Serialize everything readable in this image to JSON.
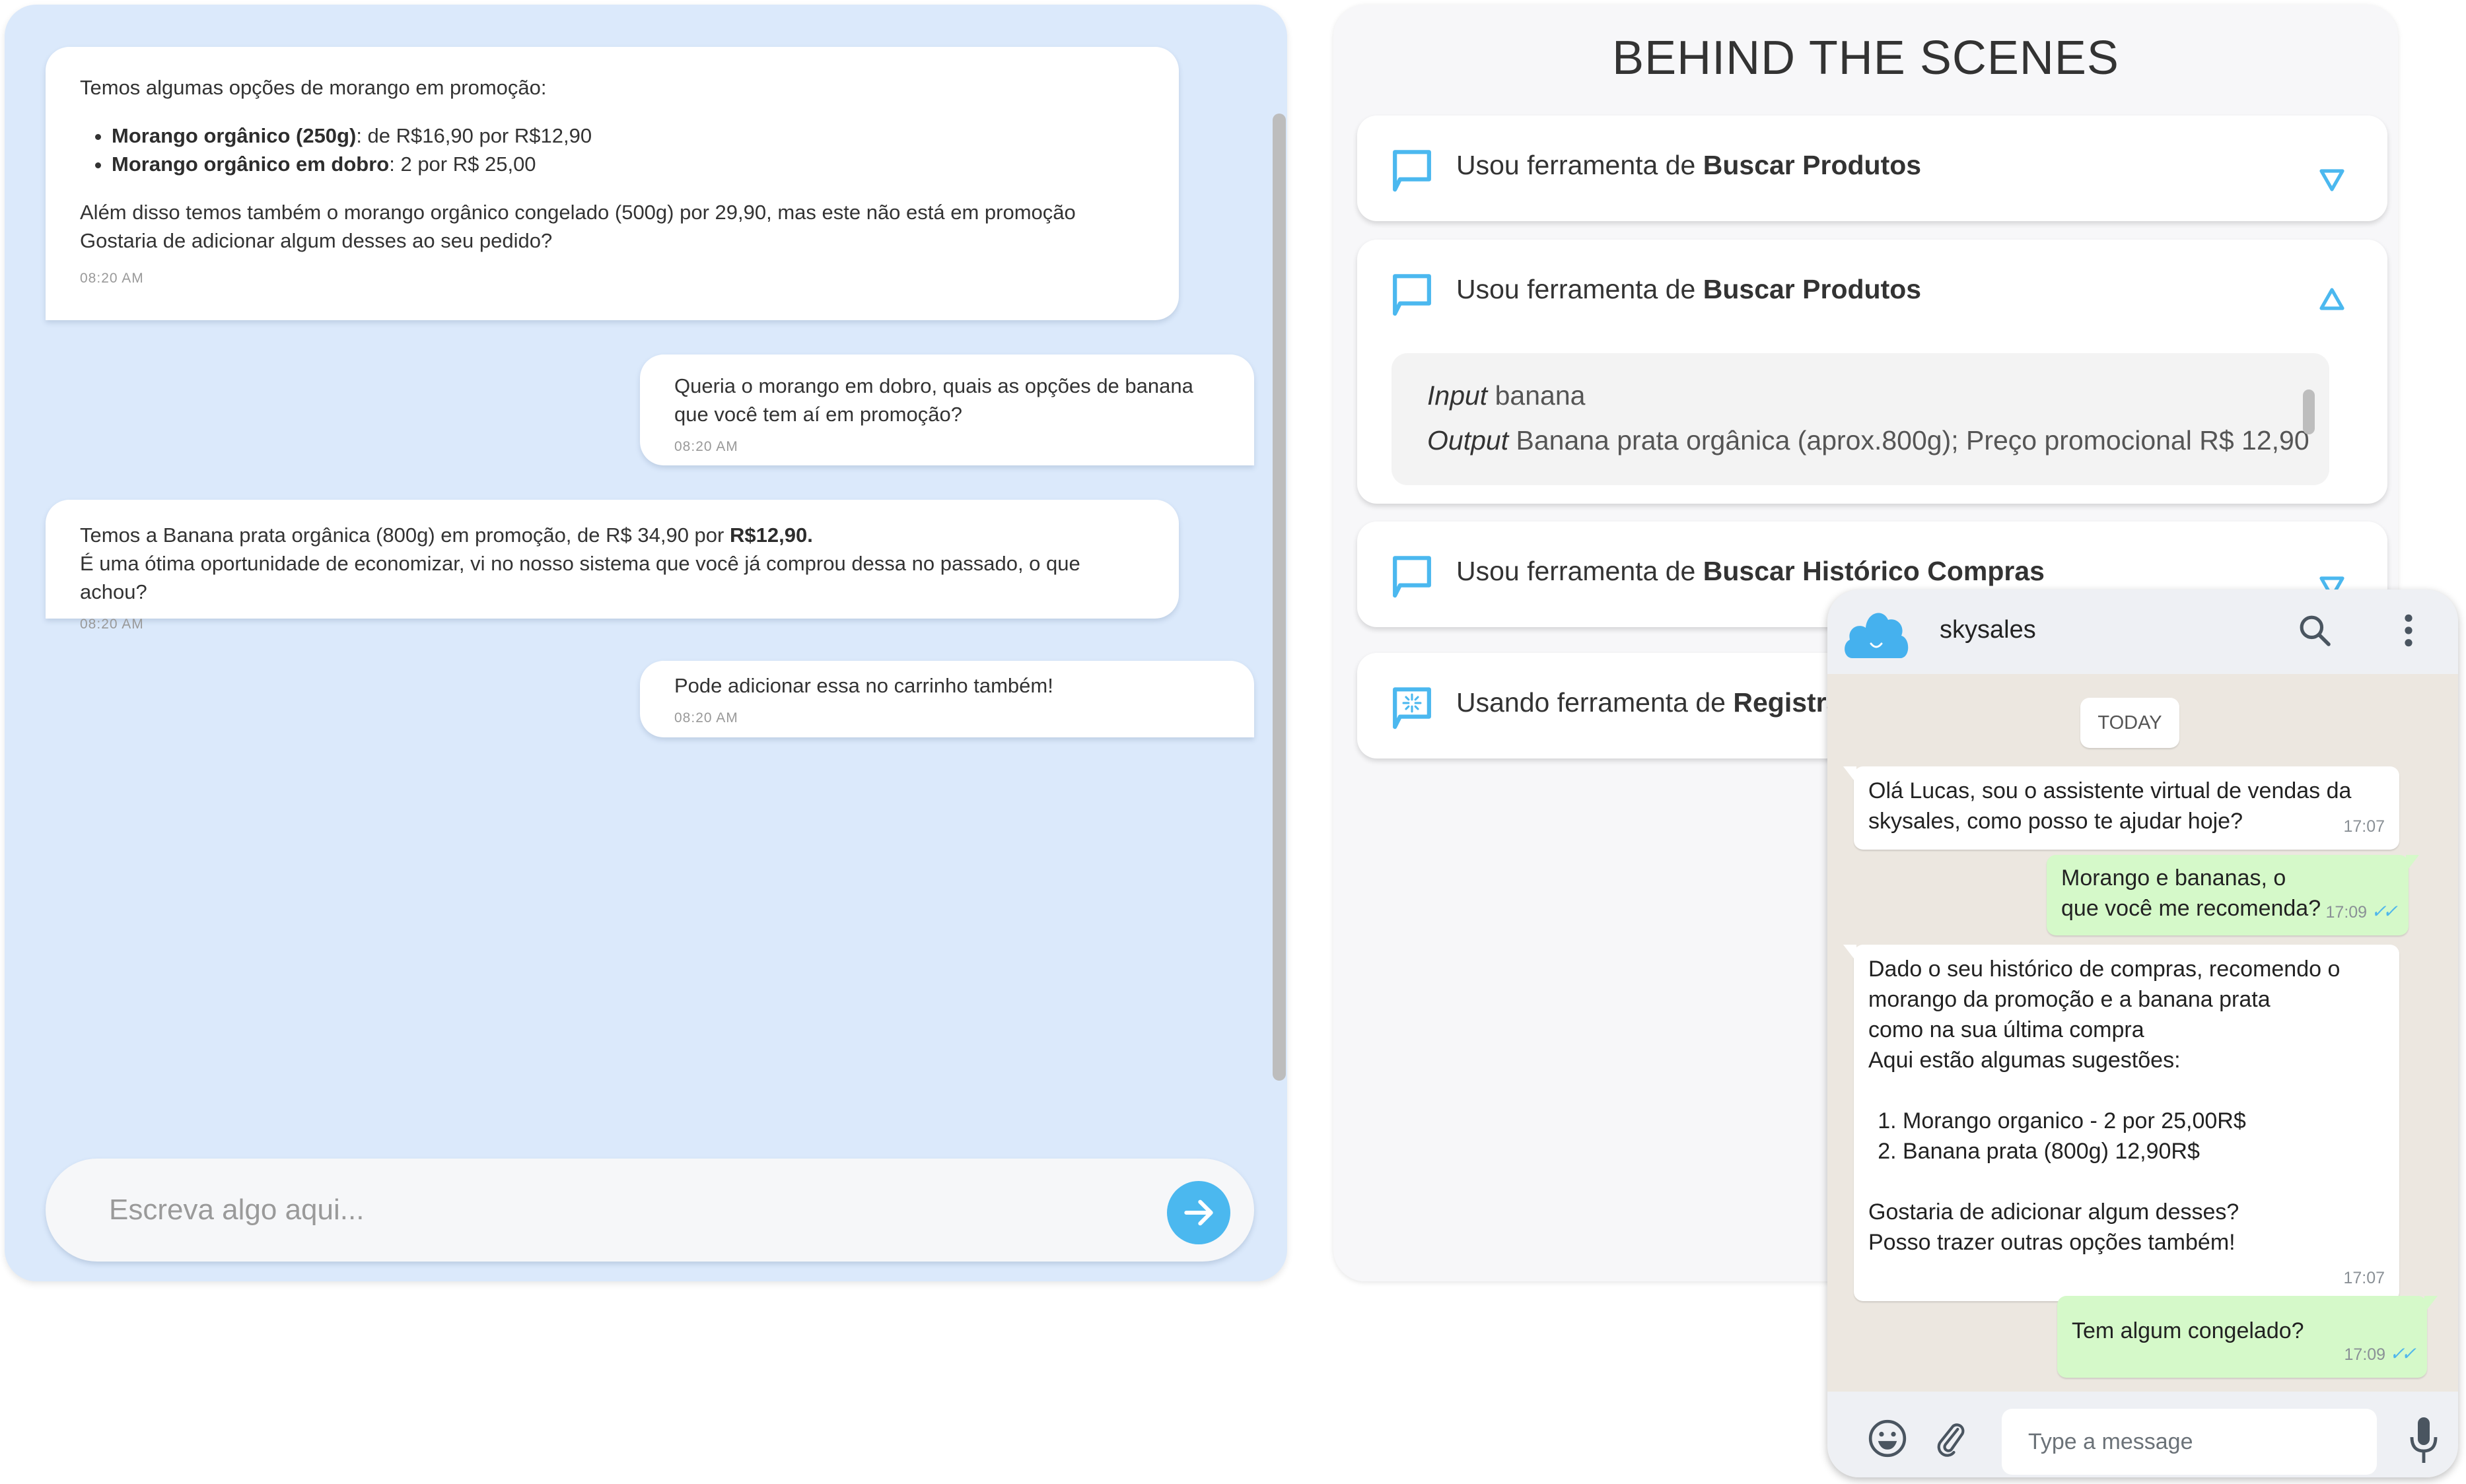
{
  "left_chat": {
    "messages": [
      {
        "role": "bot",
        "intro": "Temos algumas opções de morango em promoção:",
        "items": [
          {
            "bold": "Morango orgânico (250g)",
            "text": ": de R$16,90 por R$12,90"
          },
          {
            "bold": "Morango orgânico em dobro",
            "text": ":  2 por R$ 25,00"
          }
        ],
        "line1": "Além disso temos também o morango orgânico congelado (500g) por 29,90, mas este não está em promoção",
        "line2": "Gostaria de adicionar algum desses ao seu pedido?",
        "time": "08:20 AM"
      },
      {
        "role": "user",
        "text": "Queria o morango em dobro,  quais as opções de banana que você tem aí em promoção?",
        "time": "08:20 AM"
      },
      {
        "role": "bot",
        "line1_pre": "Temos a Banana prata orgânica (800g) em promoção, de R$ 34,90 por ",
        "line1_bold": "R$12,90.",
        "line2": "É uma ótima oportunidade de economizar, vi no nosso sistema que você já comprou dessa no passado, o que achou?",
        "time": "08:20 AM"
      },
      {
        "role": "user",
        "text": "Pode adicionar essa no carrinho também!",
        "time": "08:20 AM"
      }
    ],
    "input_placeholder": "Escreva algo aqui...",
    "send_icon": "arrow-right-icon",
    "accent_color": "#4bb8ef",
    "panel_bg": "#dbe9fb"
  },
  "behind_the_scenes": {
    "title": "BEHIND THE SCENES",
    "tools": [
      {
        "prefix": "Usou ferramenta de ",
        "name": "Buscar Produtos",
        "state": "collapsed",
        "icon": "chat-bubble-icon"
      },
      {
        "prefix": "Usou ferramenta de ",
        "name": "Buscar Produtos",
        "state": "expanded",
        "icon": "chat-bubble-icon",
        "input_label": "Input",
        "input_value": "banana",
        "output_label": "Output",
        "output_value": "Banana prata orgânica (aprox.800g); Preço promocional R$ 12,90"
      },
      {
        "prefix": "Usou ferramenta de ",
        "name": "Buscar Histórico Compras",
        "state": "collapsed",
        "icon": "chat-bubble-icon"
      },
      {
        "prefix": "Usando ferramenta de ",
        "name": "Registra",
        "state": "loading",
        "icon": "loading-bubble-icon"
      }
    ]
  },
  "phone": {
    "app_name": "skysales",
    "date_divider": "TODAY",
    "messages": [
      {
        "dir": "in",
        "text": "Olá Lucas, sou o assistente virtual de vendas da skysales, como posso te ajudar hoje?",
        "time": "17:07"
      },
      {
        "dir": "out",
        "line1": "Morango e bananas, o",
        "line2": "que você me recomenda?",
        "time": "17:09",
        "read": true
      },
      {
        "dir": "in",
        "lines": [
          "Dado o seu histórico de compras, recomendo o",
          "morango da promoção e a banana prata",
          "como na sua última compra",
          "Aqui estão algumas sugestões:"
        ],
        "list": [
          "Morango organico - 2 por 25,00R$",
          "Banana prata (800g) 12,90R$"
        ],
        "closing": [
          "Gostaria de adicionar algum desses?",
          "Posso trazer outras opções também!"
        ],
        "time": "17:07"
      },
      {
        "dir": "out",
        "text": "Tem algum congelado?",
        "time": "17:09",
        "read": true
      }
    ],
    "input_placeholder": "Type a message",
    "ticks": "✓✓",
    "colors": {
      "outgoing": "#d5f9c9",
      "chat_bg": "#ece7e0",
      "header": "#eef0f4",
      "tick": "#4fb6ec",
      "logo": "#45b1ee"
    }
  }
}
